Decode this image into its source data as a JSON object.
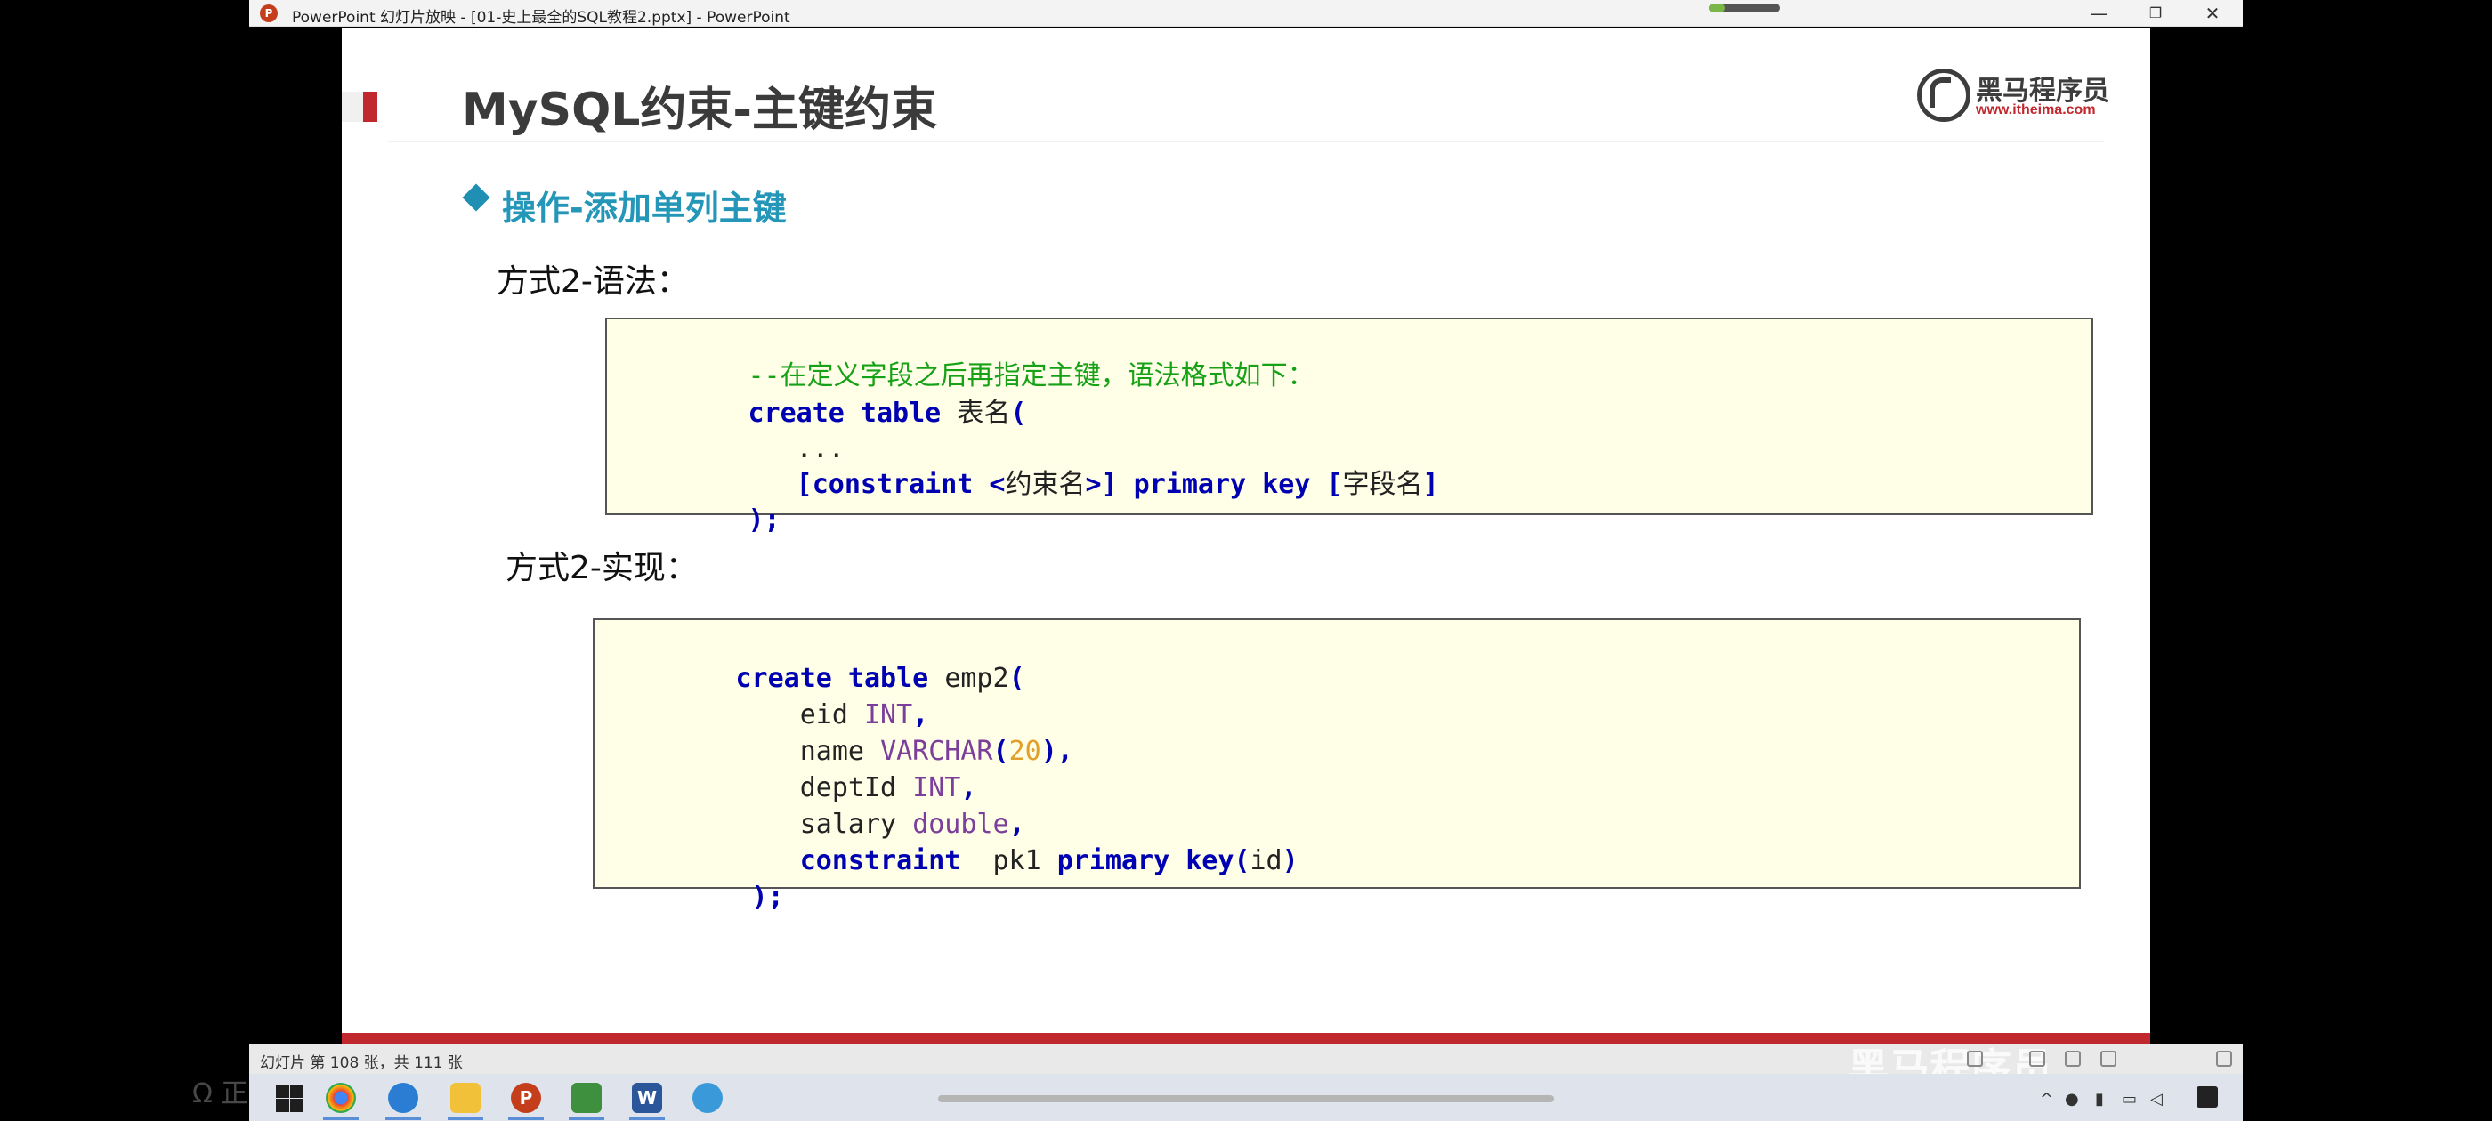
{
  "window": {
    "title": "PowerPoint 幻灯片放映 - [01-史上最全的SQL教程2.pptx] - PowerPoint",
    "app_icon_letter": "P",
    "minimize": "—",
    "restore": "❐",
    "close": "✕"
  },
  "slide": {
    "title": "MySQL约束-主键约束",
    "logo_name": "黑马程序员",
    "logo_url": "www.itheima.com",
    "section_heading": "操作-添加单列主键",
    "syntax_label": "方式2-语法：",
    "impl_label": "方式2-实现：",
    "syntax_code": {
      "comment": "--在定义字段之后再指定主键，语法格式如下：",
      "l2_kw": "create table ",
      "l2_tx": "表名",
      "l2_kw2": "(",
      "l3": "   ...",
      "l4_kw": "   [constraint <",
      "l4_tx": "约束名",
      "l4_kw2": ">] primary key [",
      "l4_tx2": "字段名",
      "l4_kw3": "]",
      "l5": ");"
    },
    "impl_code": {
      "l1_kw": "create table ",
      "l1_tx": "emp2",
      "l1_kw2": "(",
      "l2_tx": "    eid ",
      "l2_ty": "INT",
      "l2_p": ",",
      "l3_tx": "    name ",
      "l3_ty": "VARCHAR",
      "l3_p1": "(",
      "l3_nm": "20",
      "l3_p2": "),",
      "l4_tx": "    deptId ",
      "l4_ty": "INT",
      "l4_p": ",",
      "l5_tx": "    salary ",
      "l5_ty": "double",
      "l5_p": ",",
      "l6_kw": "    constraint ",
      "l6_tx": " pk1 ",
      "l6_kw2": "primary key",
      "l6_p1": "(",
      "l6_tx2": "id",
      "l6_p2": ")",
      "l7": " );"
    }
  },
  "statusbar": {
    "slide_counter": "幻灯片 第 108 张，共 111 张",
    "watermark": "黑马程序员"
  },
  "taskbar": {
    "apps": [
      "chrome-icon",
      "search-app-icon",
      "file-explorer-icon",
      "powerpoint-icon",
      "excel-like-icon",
      "word-icon",
      "browser-icon"
    ],
    "ghost_text": "Ω 正在..."
  }
}
